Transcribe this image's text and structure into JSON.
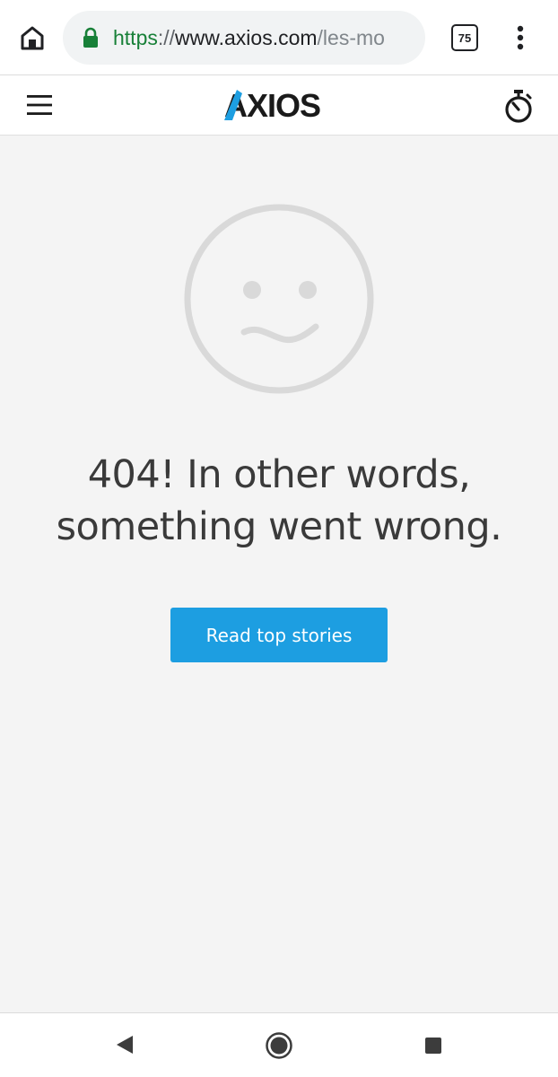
{
  "browser": {
    "url_scheme": "https",
    "url_separator": "://",
    "url_host": "www.axios.com",
    "url_path": "/les-mo",
    "tab_count": "75"
  },
  "site": {
    "logo_text": "AXIOS",
    "brand_color": "#1d9ee1"
  },
  "error": {
    "heading_line1": "404! In other words,",
    "heading_line2": "something went wrong.",
    "button_label": "Read top stories"
  },
  "icons": {
    "home": "home-icon",
    "lock": "lock-icon",
    "tabs": "tabs-icon",
    "menu": "more-vert-icon",
    "hamburger": "hamburger-icon",
    "stopwatch": "stopwatch-icon",
    "sad_face": "sad-face-icon",
    "back": "back-triangle-icon",
    "nav_home": "nav-home-circle-icon",
    "recents": "recents-square-icon"
  }
}
